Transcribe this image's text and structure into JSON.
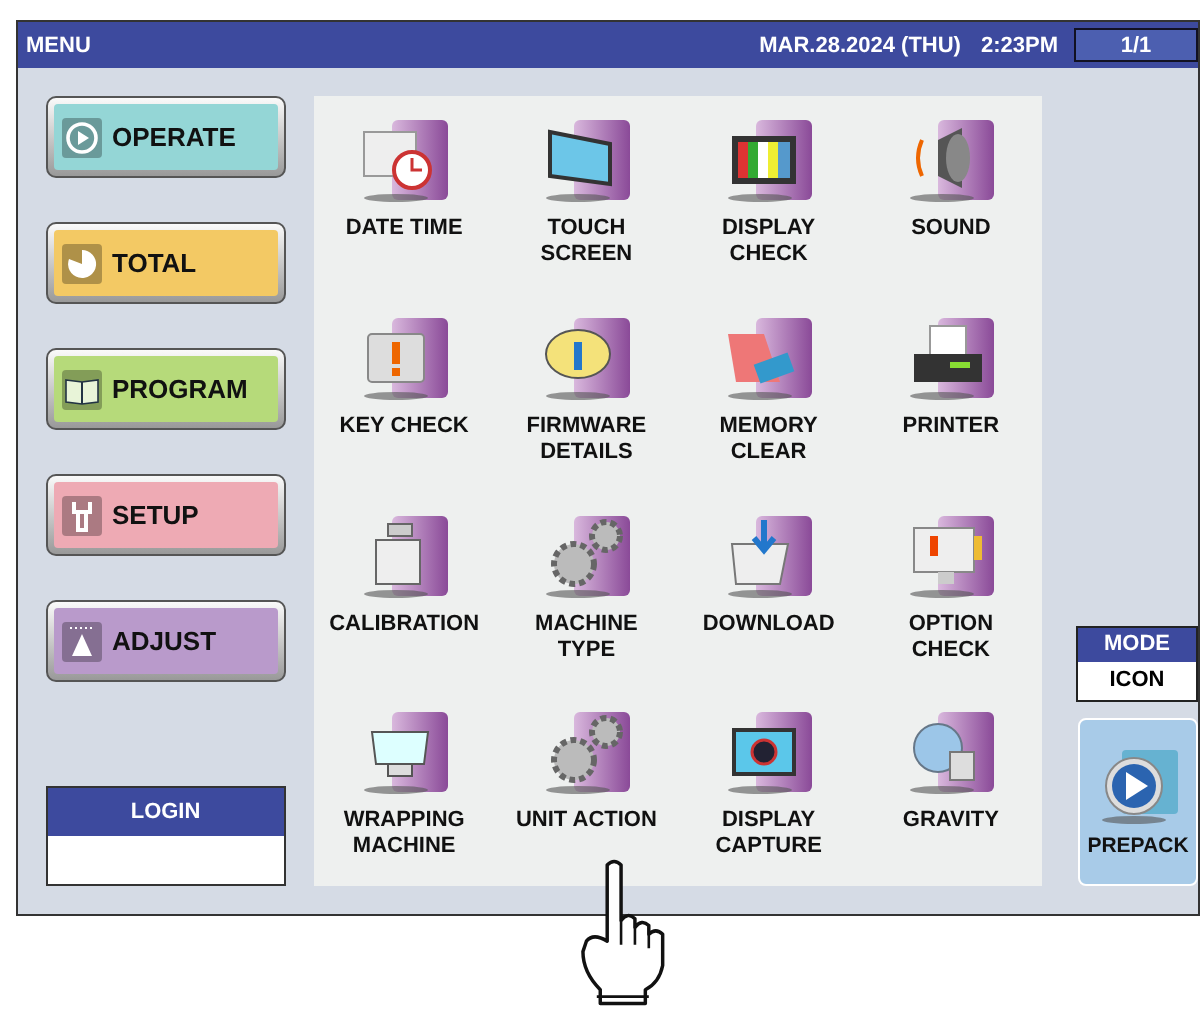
{
  "title_bar": {
    "title": "MENU",
    "date": "MAR.28.2024 (THU)",
    "time": "2:23PM",
    "page": "1/1"
  },
  "menu_buttons": [
    {
      "label": "OPERATE",
      "color": "#94d6d6"
    },
    {
      "label": "TOTAL",
      "color": "#f3c964"
    },
    {
      "label": "PROGRAM",
      "color": "#b6da7a"
    },
    {
      "label": "SETUP",
      "color": "#eeaab4"
    },
    {
      "label": "ADJUST",
      "color": "#b99acb"
    }
  ],
  "login": {
    "label": "LOGIN"
  },
  "functions": [
    {
      "label": "DATE TIME"
    },
    {
      "label": "TOUCH\nSCREEN"
    },
    {
      "label": "DISPLAY\nCHECK"
    },
    {
      "label": "SOUND"
    },
    {
      "label": "KEY CHECK"
    },
    {
      "label": "FIRMWARE\nDETAILS"
    },
    {
      "label": "MEMORY\nCLEAR"
    },
    {
      "label": "PRINTER"
    },
    {
      "label": "CALIBRATION"
    },
    {
      "label": "MACHINE\nTYPE"
    },
    {
      "label": "DOWNLOAD"
    },
    {
      "label": "OPTION\nCHECK"
    },
    {
      "label": "WRAPPING\nMACHINE"
    },
    {
      "label": "UNIT ACTION"
    },
    {
      "label": "DISPLAY\nCAPTURE"
    },
    {
      "label": "GRAVITY"
    }
  ],
  "mode": {
    "label": "MODE",
    "value": "ICON"
  },
  "prepack": {
    "label": "PREPACK"
  }
}
